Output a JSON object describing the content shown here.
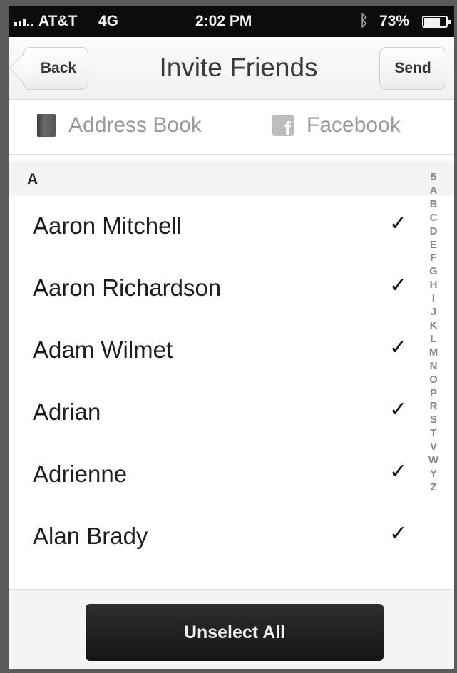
{
  "status_bar": {
    "carrier": "AT&T",
    "network": "4G",
    "time": "2:02 PM",
    "bluetooth_icon": "bluetooth-icon",
    "battery_percent": "73%",
    "battery_level": 0.73
  },
  "nav": {
    "back_label": "Back",
    "title": "Invite Friends",
    "send_label": "Send"
  },
  "sources": {
    "address_book": {
      "label": "Address Book",
      "icon": "address-book-icon"
    },
    "facebook": {
      "label": "Facebook",
      "icon": "facebook-icon"
    }
  },
  "section": {
    "header": "A"
  },
  "contacts": [
    {
      "name": "Aaron Mitchell",
      "checked": true
    },
    {
      "name": "Aaron Richardson",
      "checked": true
    },
    {
      "name": "Adam Wilmet",
      "checked": true
    },
    {
      "name": "Adrian",
      "checked": true
    },
    {
      "name": "Adrienne",
      "checked": true
    },
    {
      "name": "Alan Brady",
      "checked": true
    }
  ],
  "check_mark": "✓",
  "index_letters": [
    "5",
    "A",
    "B",
    "C",
    "D",
    "E",
    "F",
    "G",
    "H",
    "I",
    "J",
    "K",
    "L",
    "M",
    "N",
    "O",
    "P",
    "R",
    "S",
    "T",
    "V",
    "W",
    "Y",
    "Z"
  ],
  "footer": {
    "unselect_label": "Unselect All"
  },
  "colors": {
    "status_bar": "#0c0c0c",
    "button_dark": "#1a1a1a",
    "muted_text": "#9a9a9a"
  }
}
